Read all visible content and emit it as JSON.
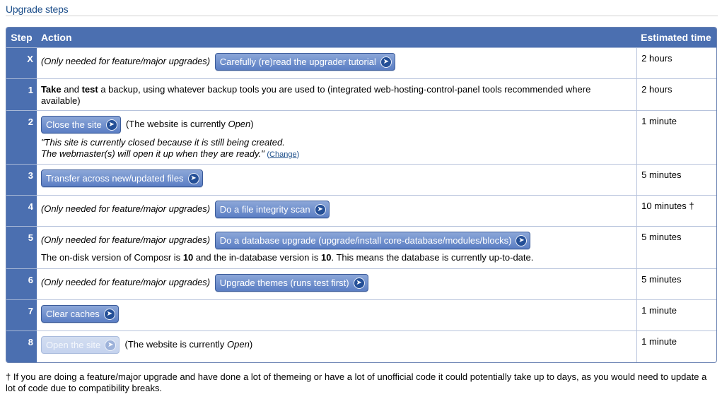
{
  "heading": "Upgrade steps",
  "table": {
    "headers": {
      "step": "Step",
      "action": "Action",
      "time": "Estimated time"
    }
  },
  "rows": {
    "x": {
      "step": "X",
      "note": "(Only needed for feature/major upgrades)",
      "button": "Carefully (re)read the upgrader tutorial",
      "time": "2 hours"
    },
    "r1": {
      "step": "1",
      "take": "Take",
      "and": "and",
      "test": "test",
      "rest": "a backup, using whatever backup tools you are used to (integrated web-hosting-control-panel tools recommended where available)",
      "time": "2 hours"
    },
    "r2": {
      "step": "2",
      "button": "Close the site",
      "status_prefix": "(The website is currently",
      "status_value": "Open",
      "status_suffix": ")",
      "message_line1": "\"This site is currently closed because it is still being created.",
      "message_line2": "The webmaster(s) will open it up when they are ready.\"",
      "change_open": "(",
      "change_label": "Change",
      "change_close": ")",
      "time": "1 minute"
    },
    "r3": {
      "step": "3",
      "button": "Transfer across new/updated files",
      "time": "5 minutes"
    },
    "r4": {
      "step": "4",
      "note": "(Only needed for feature/major upgrades)",
      "button": "Do a file integrity scan",
      "time": "10 minutes †"
    },
    "r5": {
      "step": "5",
      "note": "(Only needed for feature/major upgrades)",
      "button": "Do a database upgrade (upgrade/install core-database/modules/blocks)",
      "version_text_1": "The on-disk version of Composr is",
      "disk_version": "10",
      "version_text_2": "and the in-database version is",
      "db_version": "10",
      "version_text_3": ". This means the database is currently up-to-date.",
      "time": "5 minutes"
    },
    "r6": {
      "step": "6",
      "note": "(Only needed for feature/major upgrades)",
      "button": "Upgrade themes (runs test first)",
      "time": "5 minutes"
    },
    "r7": {
      "step": "7",
      "button": "Clear caches",
      "time": "1 minute"
    },
    "r8": {
      "step": "8",
      "button": "Open the site",
      "button_disabled": true,
      "status_prefix": "(The website is currently",
      "status_value": "Open",
      "status_suffix": ")",
      "time": "1 minute"
    }
  },
  "footnote": "† If you are doing a feature/major upgrade and have done a lot of themeing or have a lot of unofficial code it could potentially take up to days, as you would need to update a lot of code due to compatibility breaks.",
  "colors": {
    "header_bg": "#4b6fb0",
    "heading_text": "#1c4e8a",
    "button_top": "#8ca7d8",
    "button_bottom": "#5b7ec4",
    "chevron_bg": "#244f97"
  },
  "icons": {
    "button_chevron": "chevron-right-icon"
  }
}
